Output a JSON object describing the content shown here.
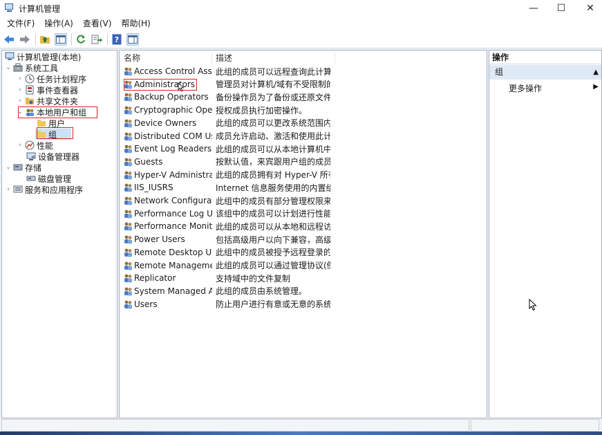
{
  "window": {
    "title": "计算机管理",
    "controls": {
      "minimize": "—",
      "maximize": "☐",
      "close": "✕"
    }
  },
  "menu": [
    "文件(F)",
    "操作(A)",
    "查看(V)",
    "帮助(H)"
  ],
  "toolbar": {
    "icons": [
      "back-arrow-icon",
      "forward-arrow-icon",
      "up-folder-icon",
      "show-hide-tree-icon",
      "refresh-icon",
      "export-list-icon",
      "help-icon",
      "console-view-icon"
    ]
  },
  "tree": {
    "root": "计算机管理(本地)",
    "system_tools": "系统工具",
    "task_scheduler": "任务计划程序",
    "event_viewer": "事件查看器",
    "shared_folders": "共享文件夹",
    "local_users": "本地用户和组",
    "users": "用户",
    "groups": "组",
    "performance": "性能",
    "device_manager": "设备管理器",
    "storage": "存储",
    "disk_management": "磁盘管理",
    "services_apps": "服务和应用程序"
  },
  "list": {
    "col_name": "名称",
    "col_desc": "描述",
    "rows": [
      {
        "name": "Access Control Assist...",
        "desc": "此组的成员可以远程查询此计算..."
      },
      {
        "name": "Administrators",
        "desc": "管理员对计算机/域有不受限制的..."
      },
      {
        "name": "Backup Operators",
        "desc": "备份操作员为了备份或还原文件..."
      },
      {
        "name": "Cryptographic Operat...",
        "desc": "授权成员执行加密操作。"
      },
      {
        "name": "Device Owners",
        "desc": "此组的成员可以更改系统范围内..."
      },
      {
        "name": "Distributed COM Users",
        "desc": "成员允许启动、激活和使用此计..."
      },
      {
        "name": "Event Log Readers",
        "desc": "此组的成员可以从本地计算机中..."
      },
      {
        "name": "Guests",
        "desc": "按默认值，来宾跟用户组的成员..."
      },
      {
        "name": "Hyper-V Administrat...",
        "desc": "此组的成员拥有对 Hyper-V 所有..."
      },
      {
        "name": "IIS_IUSRS",
        "desc": "Internet 信息服务使用的内置组。"
      },
      {
        "name": "Network Configuratio...",
        "desc": "此组中的成员有部分管理权限来..."
      },
      {
        "name": "Performance Log Users",
        "desc": "该组中的成员可以计划进行性能..."
      },
      {
        "name": "Performance Monitor...",
        "desc": "此组的成员可以从本地和远程访..."
      },
      {
        "name": "Power Users",
        "desc": "包括高级用户以向下兼容，高级..."
      },
      {
        "name": "Remote Desktop Users",
        "desc": "此组中的成员被授予远程登录的..."
      },
      {
        "name": "Remote Managemen...",
        "desc": "此组的成员可以通过管理协议(例..."
      },
      {
        "name": "Replicator",
        "desc": "支持域中的文件复制"
      },
      {
        "name": "System Managed Acc...",
        "desc": "此组的成员由系统管理。"
      },
      {
        "name": "Users",
        "desc": "防止用户进行有意或无意的系统..."
      }
    ]
  },
  "actions": {
    "header": "操作",
    "group": "组",
    "more": "更多操作"
  }
}
